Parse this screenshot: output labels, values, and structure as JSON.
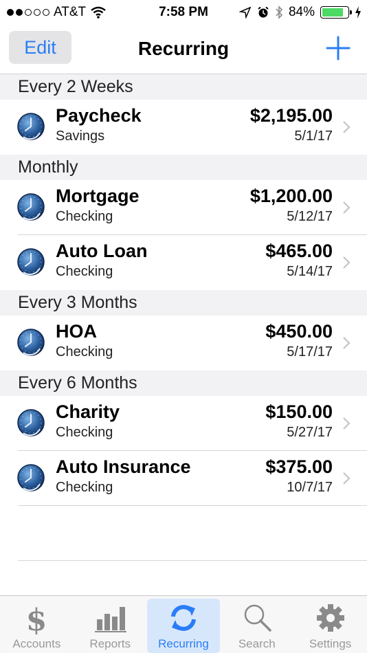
{
  "status_bar": {
    "carrier": "AT&T",
    "time": "7:58 PM",
    "battery": "84%",
    "battery_level": 0.84
  },
  "nav": {
    "edit_label": "Edit",
    "title": "Recurring"
  },
  "sections": [
    {
      "title": "Every 2 Weeks",
      "items": [
        {
          "name": "Paycheck",
          "account": "Savings",
          "amount": "$2,195.00",
          "date": "5/1/17"
        }
      ]
    },
    {
      "title": "Monthly",
      "items": [
        {
          "name": "Mortgage",
          "account": "Checking",
          "amount": "$1,200.00",
          "date": "5/12/17"
        },
        {
          "name": "Auto Loan",
          "account": "Checking",
          "amount": "$465.00",
          "date": "5/14/17"
        }
      ]
    },
    {
      "title": "Every 3 Months",
      "items": [
        {
          "name": "HOA",
          "account": "Checking",
          "amount": "$450.00",
          "date": "5/17/17"
        }
      ]
    },
    {
      "title": "Every 6 Months",
      "items": [
        {
          "name": "Charity",
          "account": "Checking",
          "amount": "$150.00",
          "date": "5/27/17"
        },
        {
          "name": "Auto Insurance",
          "account": "Checking",
          "amount": "$375.00",
          "date": "10/7/17"
        }
      ]
    }
  ],
  "tabs": [
    {
      "label": "Accounts",
      "icon": "dollar-icon"
    },
    {
      "label": "Reports",
      "icon": "bar-chart-icon"
    },
    {
      "label": "Recurring",
      "icon": "refresh-icon"
    },
    {
      "label": "Search",
      "icon": "magnifier-icon"
    },
    {
      "label": "Settings",
      "icon": "gear-icon"
    }
  ],
  "colors": {
    "accent": "#2a7df6",
    "battery": "#4cd964",
    "section_bg": "#f2f2f4"
  }
}
